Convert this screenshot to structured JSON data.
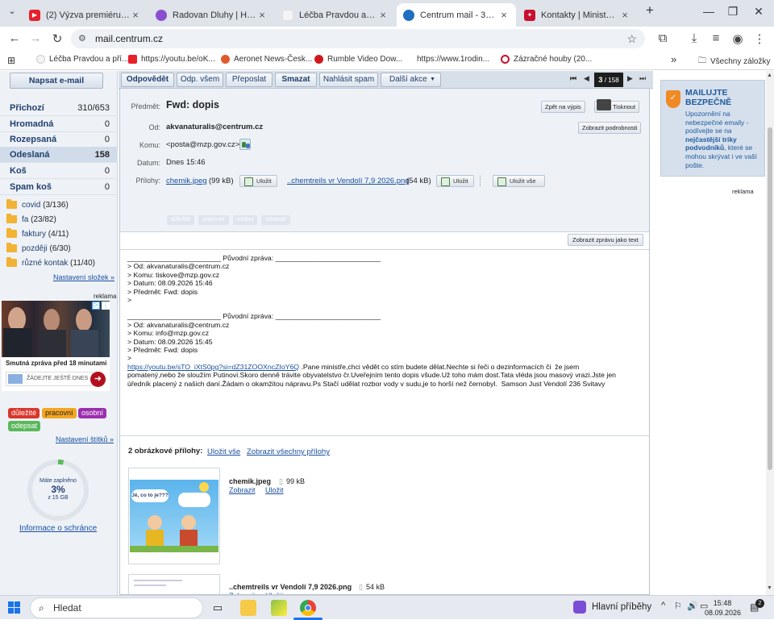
{
  "browser": {
    "tabs": [
      {
        "title": "(2) Výzva premiéru Babiš",
        "color": "#e8202a"
      },
      {
        "title": "Radovan Dluhy | Herohero",
        "color": "#8a4fd1"
      },
      {
        "title": "Léčba Pravdou a přírodní",
        "color": "#f4f4f4"
      },
      {
        "title": "Centrum mail - 357 nepřečtených",
        "color": "#1f6fbf"
      },
      {
        "title": "Kontakty | Ministerstvo životního",
        "color": "#c8102e"
      }
    ],
    "new_tab": "+",
    "url": "mail.centrum.cz",
    "bookmarks": [
      "Léčba Pravdou a pří...",
      "https://youtu.be/oK...",
      "Aeronet News-Česk...",
      "Rumble Video Dow...",
      "https://www.1rodin...",
      "Zázračné houby (20..."
    ],
    "bookmarks_more": "»",
    "all_bookmarks": "Všechny záložky"
  },
  "sidebar": {
    "compose": "Napsat e-mail",
    "folders": [
      {
        "name": "Přichozí",
        "count": "310/653"
      },
      {
        "name": "Hromadná",
        "count": "0"
      },
      {
        "name": "Rozepsaná",
        "count": "0"
      },
      {
        "name": "Odeslaná",
        "count": "158"
      },
      {
        "name": "Koš",
        "count": "0"
      },
      {
        "name": "Spam koš",
        "count": "0"
      }
    ],
    "subfolders": [
      {
        "name": "covid",
        "count": "(3/136)",
        "bold": "3"
      },
      {
        "name": "fa",
        "count": "(23/82)",
        "bold": "23"
      },
      {
        "name": "faktury",
        "count": "(4/11)",
        "bold": "4"
      },
      {
        "name": "později",
        "count": "(6/30)",
        "bold": "6"
      },
      {
        "name": "různé kontak",
        "count": "(11/40)",
        "bold": "11"
      }
    ],
    "folder_settings": "Nastavení složek »",
    "ad_label": "reklama",
    "ad_title": "Smutná zpráva před 18 minutami",
    "ad_search": "ŽÁDEJTE JEŠTĚ DNES",
    "labels": [
      {
        "name": "důležité",
        "bg": "#d9362b",
        "fg": "#fff"
      },
      {
        "name": "pracovní",
        "bg": "#f3a623",
        "fg": "#222"
      },
      {
        "name": "osobní",
        "bg": "#9b2fae",
        "fg": "#fff"
      },
      {
        "name": "odepsat",
        "bg": "#5cb85c",
        "fg": "#fff"
      }
    ],
    "label_settings": "Nastavení štítků »",
    "storage_title": "Máte zaplněno",
    "storage_pct": "3%",
    "storage_of": "z 15 GB",
    "storage_fraction": 0.03,
    "storage_link": "Informace o schránce"
  },
  "toolbar": {
    "reply": "Odpovědět",
    "reply_all": "Odp. všem",
    "forward": "Přeposlat",
    "delete": "Smazat",
    "spam": "Nahlásit spam",
    "more": "Další akce",
    "pager_current": "3",
    "pager_total": "/ 158"
  },
  "message": {
    "subject_label": "Předmět:",
    "subject": "Fwd: dopis",
    "back": "Zpět na výpis",
    "print": "Tisknout",
    "from_label": "Od:",
    "from": "akvanaturalis@centrum.cz",
    "show_details": "Zobrazit podrobnosti",
    "to_label": "Komu:",
    "to": "<posta@mzp.gov.cz>",
    "date_label": "Datum:",
    "date": "Dnes 15:46",
    "att_label": "Přílohy:",
    "att1_name": "chemik.jpeg",
    "att1_size": "(99 kB)",
    "save": "Uložit",
    "att2_name": "..chemtreils vr Vendolí 7,9 2026.png",
    "att2_size": "(54 kB)",
    "save_all": "Uložit vše",
    "ghost_labels": [
      "důležité",
      "pracovní",
      "osobní",
      "odepsat"
    ],
    "show_text": "Zobrazit zprávu jako text",
    "body_lines": [
      "________________________ Původní zpráva: ___________________________",
      "> Od: akvanaturalis@centrum.cz",
      "> Komu: tiskove@mzp.gov.cz",
      "> Datum: 08.09.2026 15:46",
      "> Předmět: Fwd: dopis",
      ">",
      "",
      "________________________ Původní zpráva: ___________________________",
      "> Od: akvanaturalis@centrum.cz",
      "> Komu: info@mzp.gov.cz",
      "> Datum: 08.09.2026 15:45",
      "> Předmět: Fwd: dopis",
      ">"
    ],
    "body_link": "https://youtu.be/sTO_iXtS0pg?si=dZ31ZOOXncZIoY6Q",
    "body_text1": " .Pane ministře,chci vědět co stím budete dělat.Nechte si řeči o dezinformacích či  že jsem",
    "body_text2": "pomatený,nebo že sloužím Putinovi.Skoro denně trávite obyvatelstvo čr.Uveřejním tento dopis všude.Už toho mám dost.Tata vléda jsou masový vrazi.Jste jen",
    "body_text3": "úředník placený z našich daní.Žádam o okamžitou nápravu.Ps Stačí udělat rozbor vody v sudu,je to horší než černobyl.  Samson Just Vendolí 236 Svitavy",
    "img_count": "2 obrázkové přílohy:",
    "img_save_all": "Uložit vše",
    "img_show_all": "Zobrazit všechny přílohy",
    "img1_caption": "Jé, co to je???",
    "img1_name": "chemik.jpeg",
    "img1_size": "99 kB",
    "img2_name": "..chemtreils vr Vendolí 7,9 2026.png",
    "img2_size": "54 kB",
    "show": "Zobrazit"
  },
  "right": {
    "safe_title1": "MAILUJTE",
    "safe_title2": "BEZPEČNĚ",
    "safe_t1": "Upozornění na nebezpečné emaily - podívejte se na ",
    "safe_bold": "nejčastější triky podvodníků",
    "safe_t2": ", které se mohou skrývat i ve vaší pošte.",
    "ad": "reklama"
  },
  "taskbar": {
    "search": "Hledat",
    "news": "Hlavní příběhy",
    "time": "15:48",
    "date": "08.09.2026",
    "notif": "2"
  }
}
